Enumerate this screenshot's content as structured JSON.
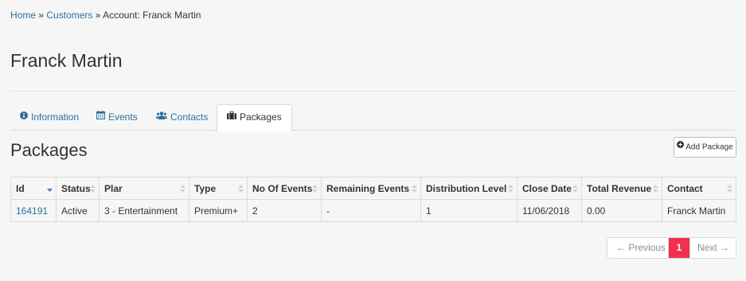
{
  "breadcrumb": {
    "home": "Home",
    "sep1": "»",
    "customers": "Customers",
    "sep2": "»",
    "current": "Account: Franck Martin"
  },
  "page_title": "Franck Martin",
  "tabs": [
    {
      "label": "Information",
      "icon": "info-circle-icon"
    },
    {
      "label": "Events",
      "icon": "calendar-icon"
    },
    {
      "label": "Contacts",
      "icon": "users-icon"
    },
    {
      "label": "Packages",
      "icon": "briefcase-icon",
      "active": true
    }
  ],
  "section_title": "Packages",
  "add_button": {
    "label": "Add Package",
    "icon": "plus-circle-icon"
  },
  "table": {
    "headers": [
      "Id",
      "Status",
      "Plar",
      "Type",
      "No Of Events",
      "Remaining Events",
      "Distribution Level",
      "Close Date",
      "Total Revenue",
      "Contact"
    ],
    "rows": [
      [
        "164191",
        "Active",
        "3 - Entertainment",
        "Premium+",
        "2",
        "-",
        "1",
        "11/06/2018",
        "0.00",
        "Franck Martin"
      ]
    ]
  },
  "pagination": {
    "previous": "← Previous",
    "current": "1",
    "next": "Next →"
  },
  "colors": {
    "link": "#2f6f9f",
    "active_page": "#f0304f",
    "background": "#f5f6f5",
    "sort_active": "#4a7fc0"
  }
}
